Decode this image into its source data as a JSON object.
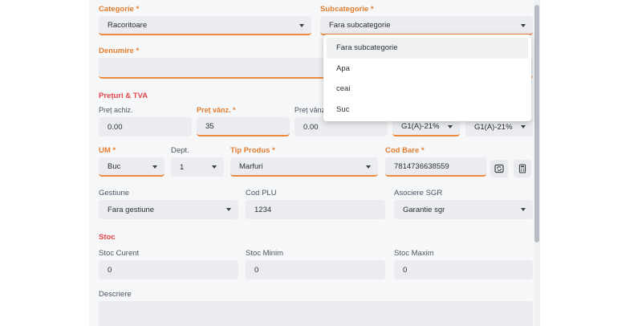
{
  "categorie": {
    "label": "Categorie *",
    "value": "Racoritoare"
  },
  "subcategorie": {
    "label": "Subcategorie *",
    "value": "Fara subcategorie",
    "options": [
      "Fara subcategorie",
      "Apa",
      "ceai",
      "Suc"
    ]
  },
  "denumire": {
    "label": "Denumire *",
    "value": ""
  },
  "preturi": {
    "section_title": "Prețuri & TVA",
    "pret_achiz_label": "Preț achiz.",
    "pret_achiz_value": "0.00",
    "pret_vanz_label": "Preț vânz. *",
    "pret_vanz_value": "35",
    "pret_vanz2_label": "Preț vânz",
    "pret_vanz2_value": "0.00",
    "tva1_value": "G1(A)-21%",
    "tva2_value": "G1(A)-21%"
  },
  "um": {
    "label": "UM *",
    "value": "Buc"
  },
  "dept": {
    "label": "Dept.",
    "value": "1"
  },
  "tip_produs": {
    "label": "Tip Produs *",
    "value": "Marfuri"
  },
  "cod_bare": {
    "label": "Cod Bare *",
    "value": "7814736638559"
  },
  "gestiune": {
    "label": "Gestiune",
    "value": "Fara gestiune"
  },
  "cod_plu": {
    "label": "Cod PLU",
    "value": "1234"
  },
  "asociere_sgr": {
    "label": "Asociere SGR",
    "value": "Garantie sgr"
  },
  "stoc": {
    "section_title": "Stoc",
    "curent_label": "Stoc Curent",
    "curent_value": "0",
    "minim_label": "Stoc Minim",
    "minim_value": "0",
    "maxim_label": "Stoc Maxim",
    "maxim_value": "0"
  },
  "descriere": {
    "label": "Descriere",
    "value": ""
  },
  "icons": {
    "generate": "barcode-generate-icon",
    "calc": "calculator-icon"
  },
  "colors": {
    "accent": "#ef8a3c",
    "required_label": "#e27c2d",
    "section": "#e5484d"
  }
}
